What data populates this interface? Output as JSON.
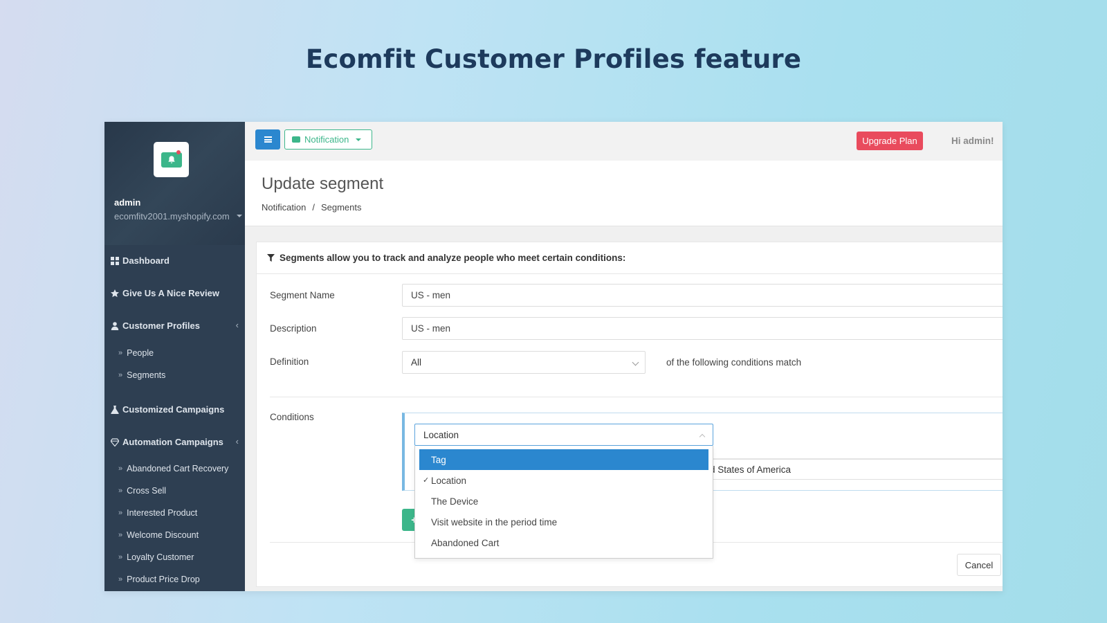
{
  "hero": {
    "title": "Ecomfit Customer Profiles feature"
  },
  "sidebar": {
    "user_name": "admin",
    "shop": "ecomfitv2001.myshopify.com",
    "nav": [
      {
        "label": "Dashboard",
        "icon": "dashboard-icon"
      },
      {
        "label": "Give Us A Nice Review",
        "icon": "star-icon"
      },
      {
        "label": "Customer Profiles",
        "icon": "user-icon"
      },
      {
        "label": "Customized Campaigns",
        "icon": "flask-icon"
      },
      {
        "label": "Automation Campaigns",
        "icon": "diamond-icon"
      }
    ],
    "customer_profiles_sub": [
      "People",
      "Segments"
    ],
    "automation_sub": [
      "Abandoned Cart Recovery",
      "Cross Sell",
      "Interested Product",
      "Welcome Discount",
      "Loyalty Customer",
      "Product Price Drop"
    ]
  },
  "topbar": {
    "notification_label": "Notification",
    "upgrade_label": "Upgrade Plan",
    "greeting": "Hi admin!"
  },
  "header": {
    "title": "Update segment",
    "breadcrumb": [
      "Notification",
      "/",
      "Segments"
    ]
  },
  "panel": {
    "heading": "Segments allow you to track and analyze people who meet certain conditions:",
    "segment_name_label": "Segment Name",
    "segment_name_value": "US - men",
    "description_label": "Description",
    "description_value": "US - men",
    "definition_label": "Definition",
    "definition_value": "All",
    "definition_suffix": "of the following conditions match",
    "conditions_label": "Conditions",
    "condition_select": "Location",
    "condition_value": "d States of America",
    "add_label": "+",
    "cancel_label": "Cancel"
  },
  "dropdown": {
    "options": [
      "Tag",
      "Location",
      "The Device",
      "Visit website in the period time",
      "Abandoned Cart"
    ],
    "highlighted": "Tag",
    "checked": "Location",
    "check_mark": "✓"
  },
  "colors": {
    "sidebar": "#2e3f52",
    "primary": "#2b87cf",
    "success": "#3cb68a",
    "danger": "#e94b5d"
  }
}
